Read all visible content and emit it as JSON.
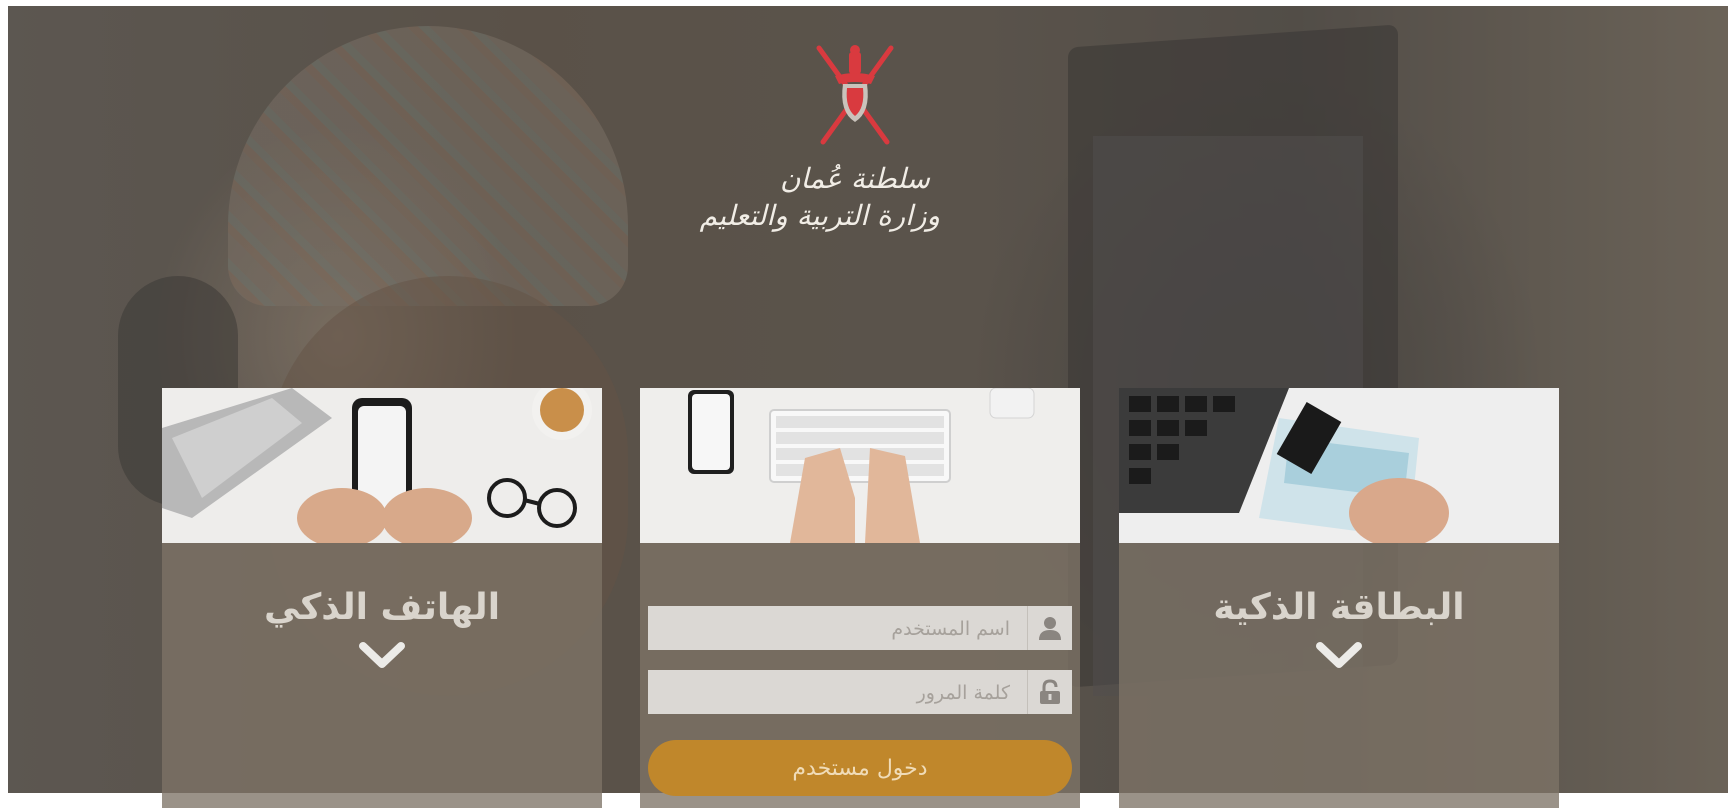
{
  "header": {
    "emblem_line_1": "سلطنة عُمان",
    "emblem_line_2": "وزارة التربية والتعليم"
  },
  "cards": {
    "smart_phone": {
      "title": "الهاتف الذكي"
    },
    "smart_card": {
      "title": "البطاقة الذكية"
    }
  },
  "login": {
    "username_placeholder": "اسم المستخدم",
    "password_placeholder": "كلمة المرور",
    "submit_label": "دخول مستخدم"
  },
  "colors": {
    "accent_button": "#c0872b",
    "emblem_red": "#d93a3f",
    "card_overlay": "#7d7366"
  },
  "icons": {
    "username": "user-icon",
    "password": "unlock-icon",
    "expand": "chevron-down-icon"
  }
}
